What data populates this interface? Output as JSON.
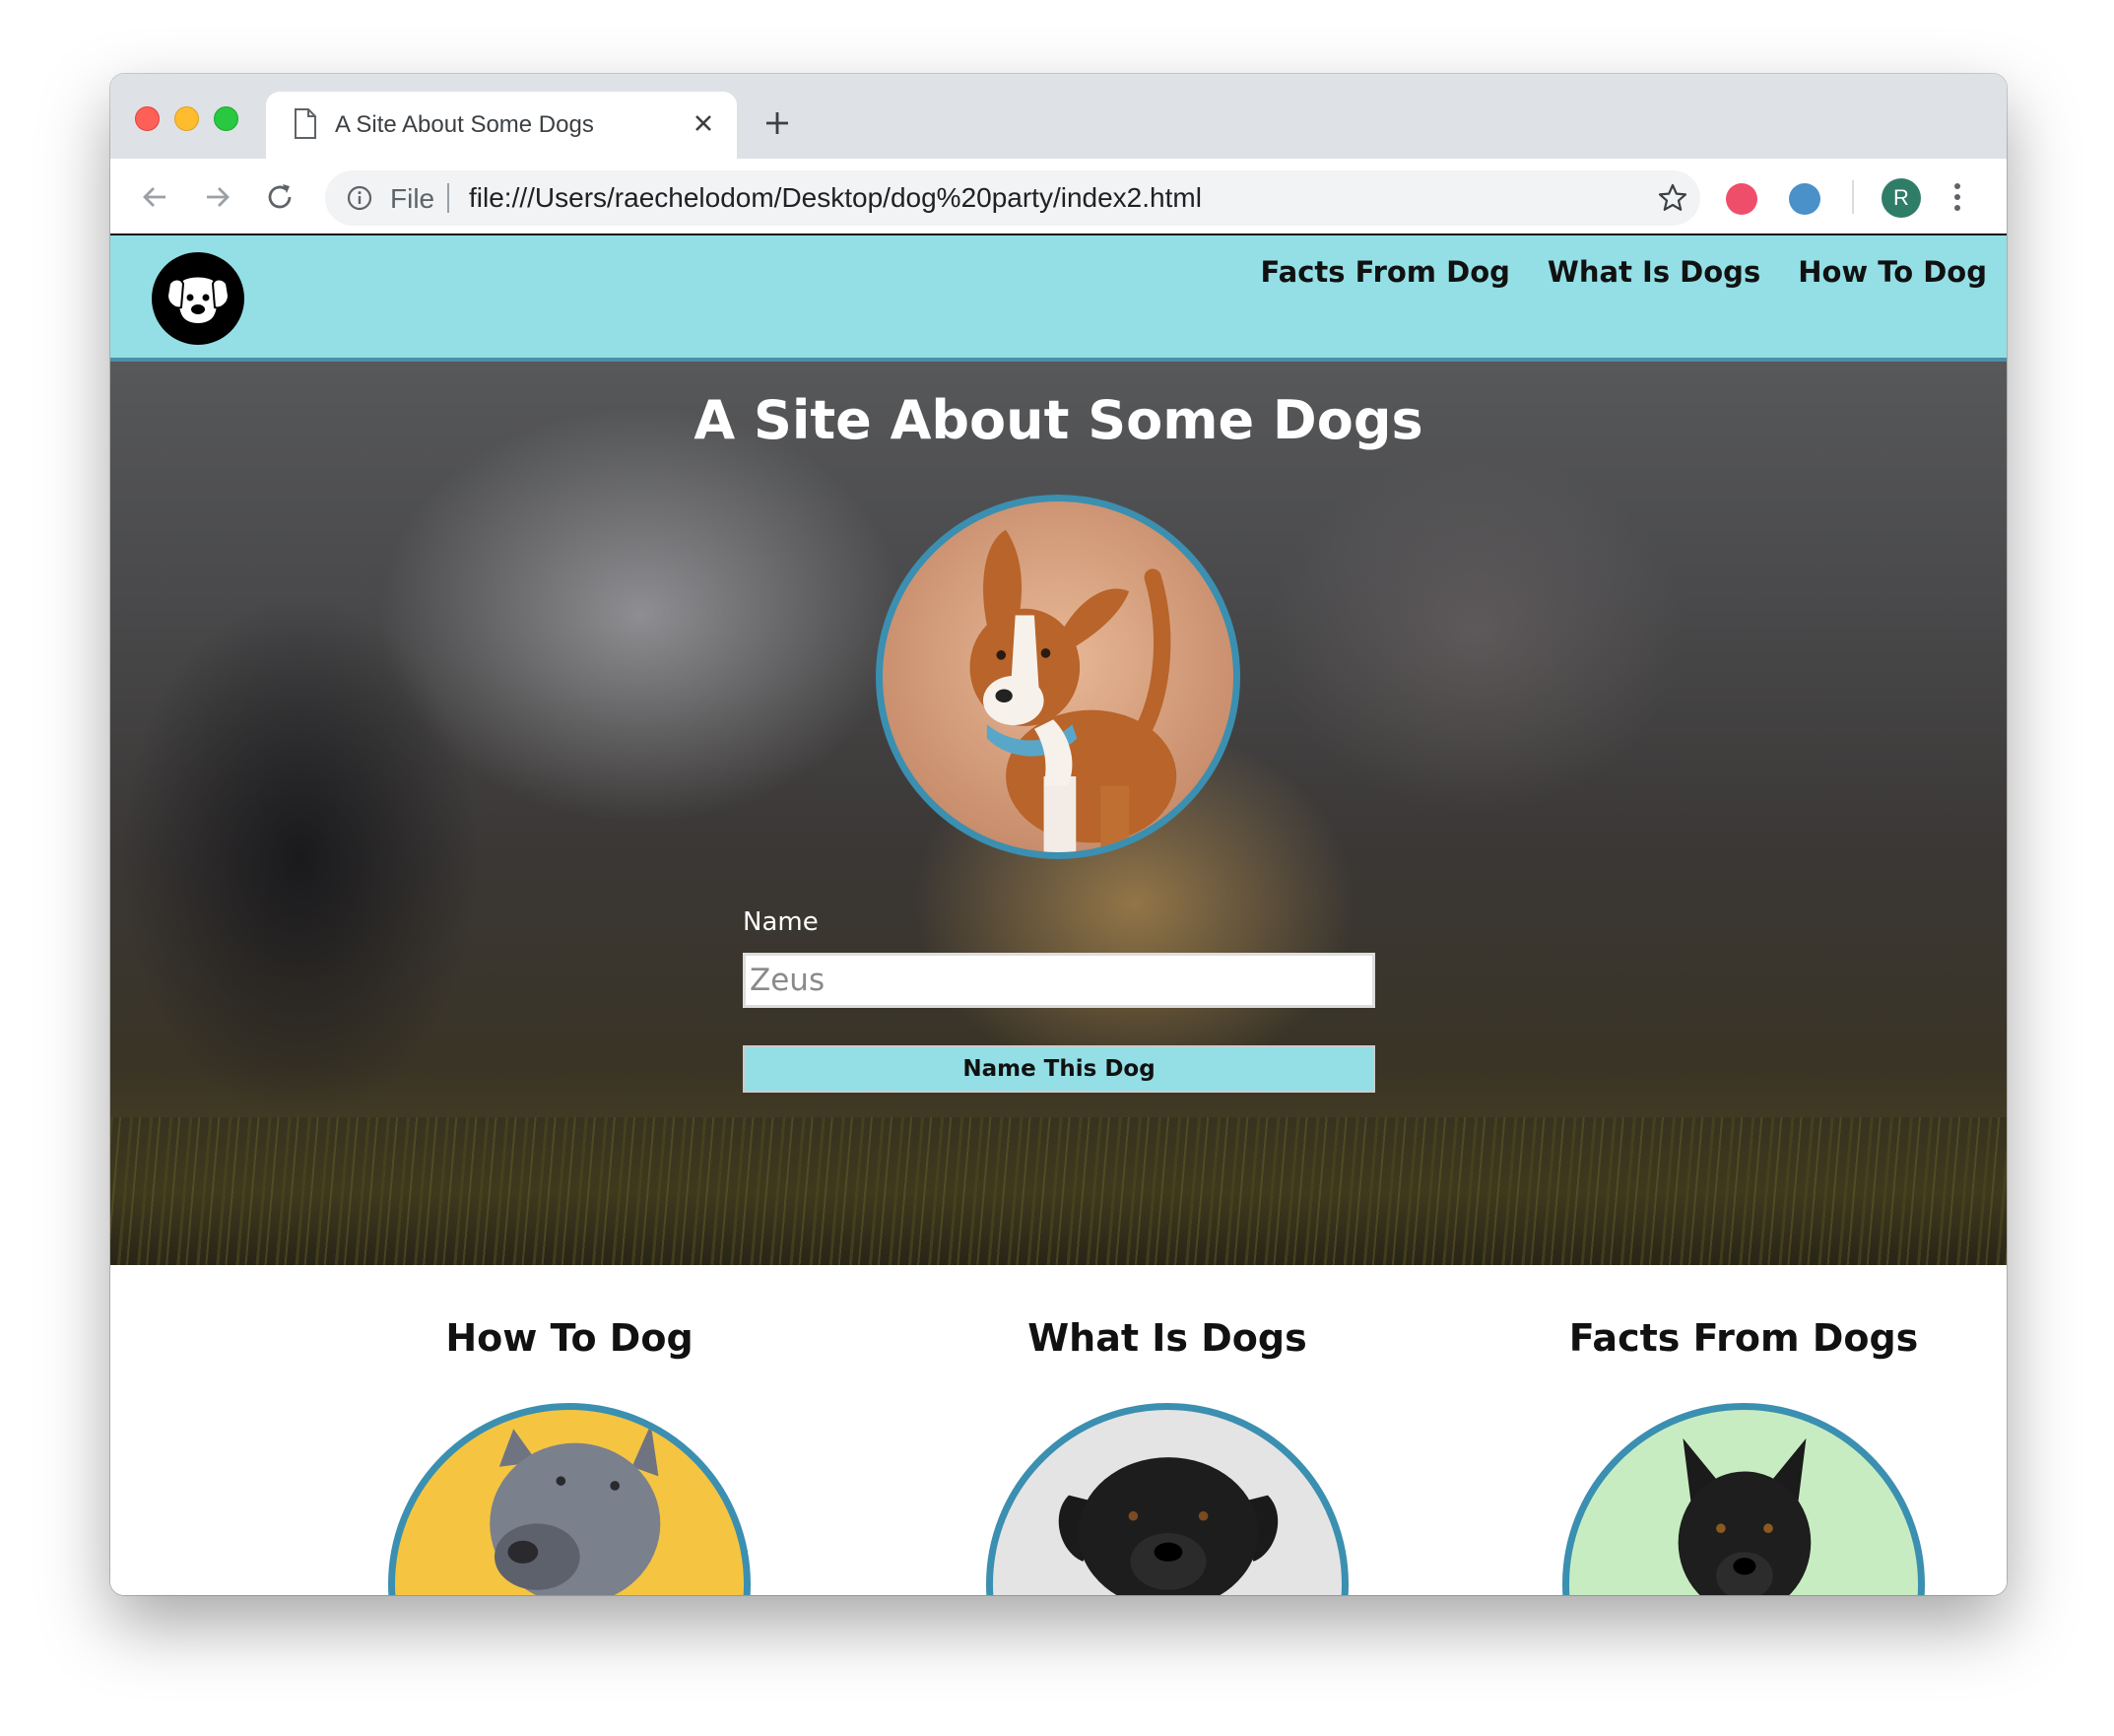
{
  "browser": {
    "tab_title": "A Site About Some Dogs",
    "omnibox_file_label": "File",
    "url": "file:///Users/raechelodom/Desktop/dog%20party/index2.html",
    "profile_initial": "R"
  },
  "site": {
    "nav": [
      "Facts From Dog",
      "What Is Dogs",
      "How To Dog"
    ],
    "hero": {
      "title_plain": "A Site About ",
      "title_bold": "Some Dogs",
      "form_label": "Name",
      "input_placeholder": "Zeus",
      "button_label": "Name This Dog"
    },
    "features": [
      {
        "title": "How To Dog",
        "photo_bg": "#f5c542"
      },
      {
        "title": "What Is Dogs",
        "photo_bg": "#e4e4e4"
      },
      {
        "title": "Facts From Dogs",
        "photo_bg": "#c8ecc2"
      }
    ]
  },
  "colors": {
    "header_bg": "#93dfe5",
    "accent_border": "#3b8fb0"
  }
}
